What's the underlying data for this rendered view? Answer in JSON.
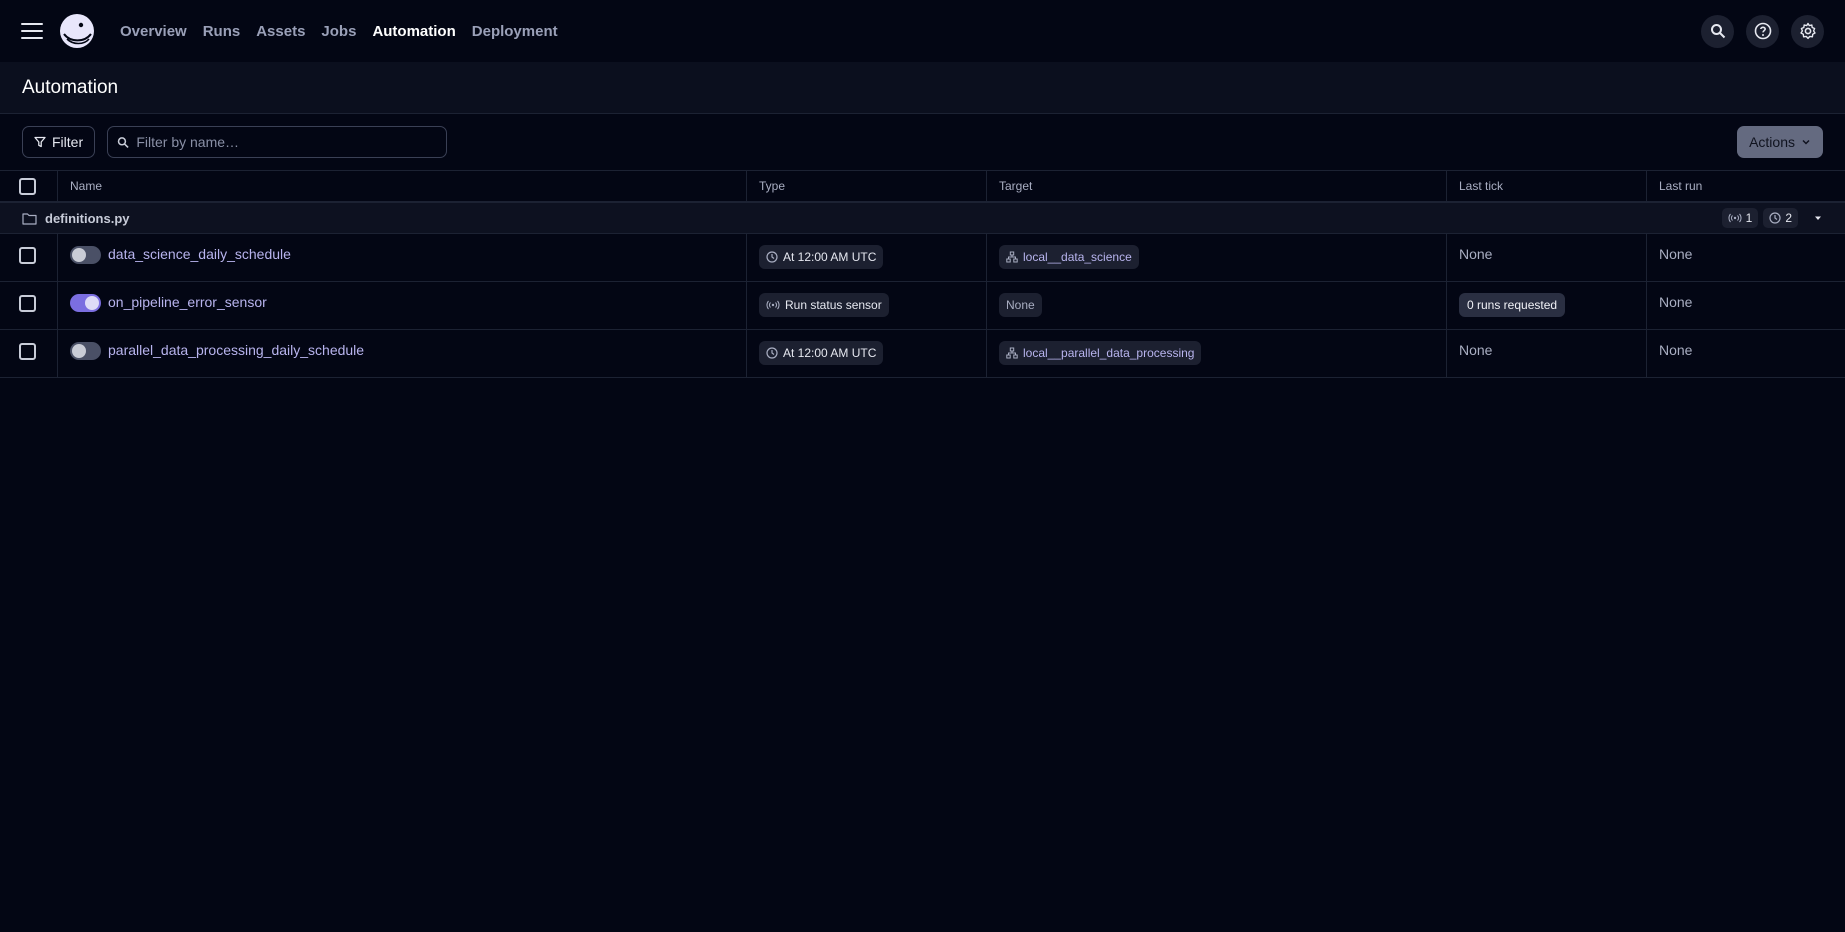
{
  "nav": {
    "links": [
      "Overview",
      "Runs",
      "Assets",
      "Jobs",
      "Automation",
      "Deployment"
    ],
    "active": "Automation"
  },
  "header": {
    "title": "Automation"
  },
  "toolbar": {
    "filter_label": "Filter",
    "search_placeholder": "Filter by name…",
    "search_value": "",
    "actions_label": "Actions"
  },
  "table": {
    "columns": {
      "name": "Name",
      "type": "Type",
      "target": "Target",
      "last_tick": "Last tick",
      "last_run": "Last run"
    },
    "group": {
      "label": "definitions.py",
      "sensor_count": "1",
      "schedule_count": "2"
    },
    "rows": [
      {
        "name": "data_science_daily_schedule",
        "enabled": false,
        "type_icon": "clock-icon",
        "type": "At 12:00 AM UTC",
        "target_icon": "job-icon",
        "target": "local__data_science",
        "last_tick": "None",
        "last_run": "None"
      },
      {
        "name": "on_pipeline_error_sensor",
        "enabled": true,
        "type_icon": "sensor-icon",
        "type": "Run status sensor",
        "target_icon": "",
        "target": "None",
        "last_tick": "0 runs requested",
        "last_run": "None"
      },
      {
        "name": "parallel_data_processing_daily_schedule",
        "enabled": false,
        "type_icon": "clock-icon",
        "type": "At 12:00 AM UTC",
        "target_icon": "job-icon",
        "target": "local__parallel_data_processing",
        "last_tick": "None",
        "last_run": "None"
      }
    ]
  },
  "colors": {
    "background": "#030614",
    "accent": "#7b6ee0",
    "link": "#b8b4ee"
  }
}
